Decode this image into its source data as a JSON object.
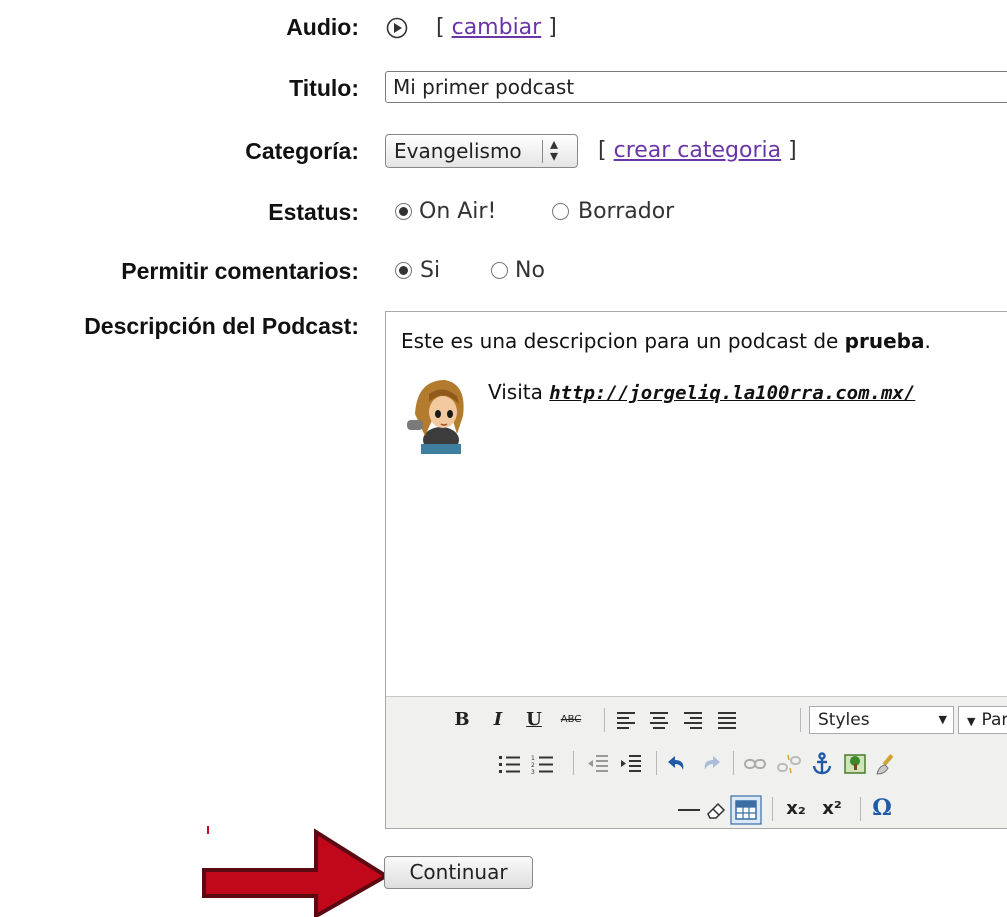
{
  "form": {
    "audio": {
      "label": "Audio:",
      "bracket_open": "[",
      "link": "cambiar",
      "bracket_close": "]"
    },
    "titulo": {
      "label": "Titulo:",
      "value": "Mi primer podcast"
    },
    "categoria": {
      "label": "Categoría:",
      "selected": "Evangelismo",
      "bracket_open": "[",
      "link": "crear categoria",
      "bracket_close": "]"
    },
    "estatus": {
      "label": "Estatus:",
      "options": [
        "On Air!",
        "Borrador"
      ],
      "selected_index": 0
    },
    "comentarios": {
      "label": "Permitir comentarios:",
      "options": [
        "Si",
        "No"
      ],
      "selected_index": 0
    },
    "descripcion": {
      "label": "Descripción del Podcast:",
      "text_before": "Este es una descripcion para un podcast de ",
      "text_bold": "prueba",
      "text_after": ".",
      "visit_label": "Visita ",
      "visit_link": "http://jorgeliq.la100rra.com.mx/"
    }
  },
  "editor_toolbar": {
    "bold": "B",
    "italic": "I",
    "underline": "U",
    "strike": "ABC",
    "styles_select": "Styles",
    "format_select": "Par",
    "subscript": "x₂",
    "superscript": "x²",
    "omega": "Ω"
  },
  "continue_button": "Continuar",
  "colors": {
    "link": "#6a35a6",
    "arrow_fill": "#c0081a",
    "arrow_stroke": "#5a0a10"
  }
}
